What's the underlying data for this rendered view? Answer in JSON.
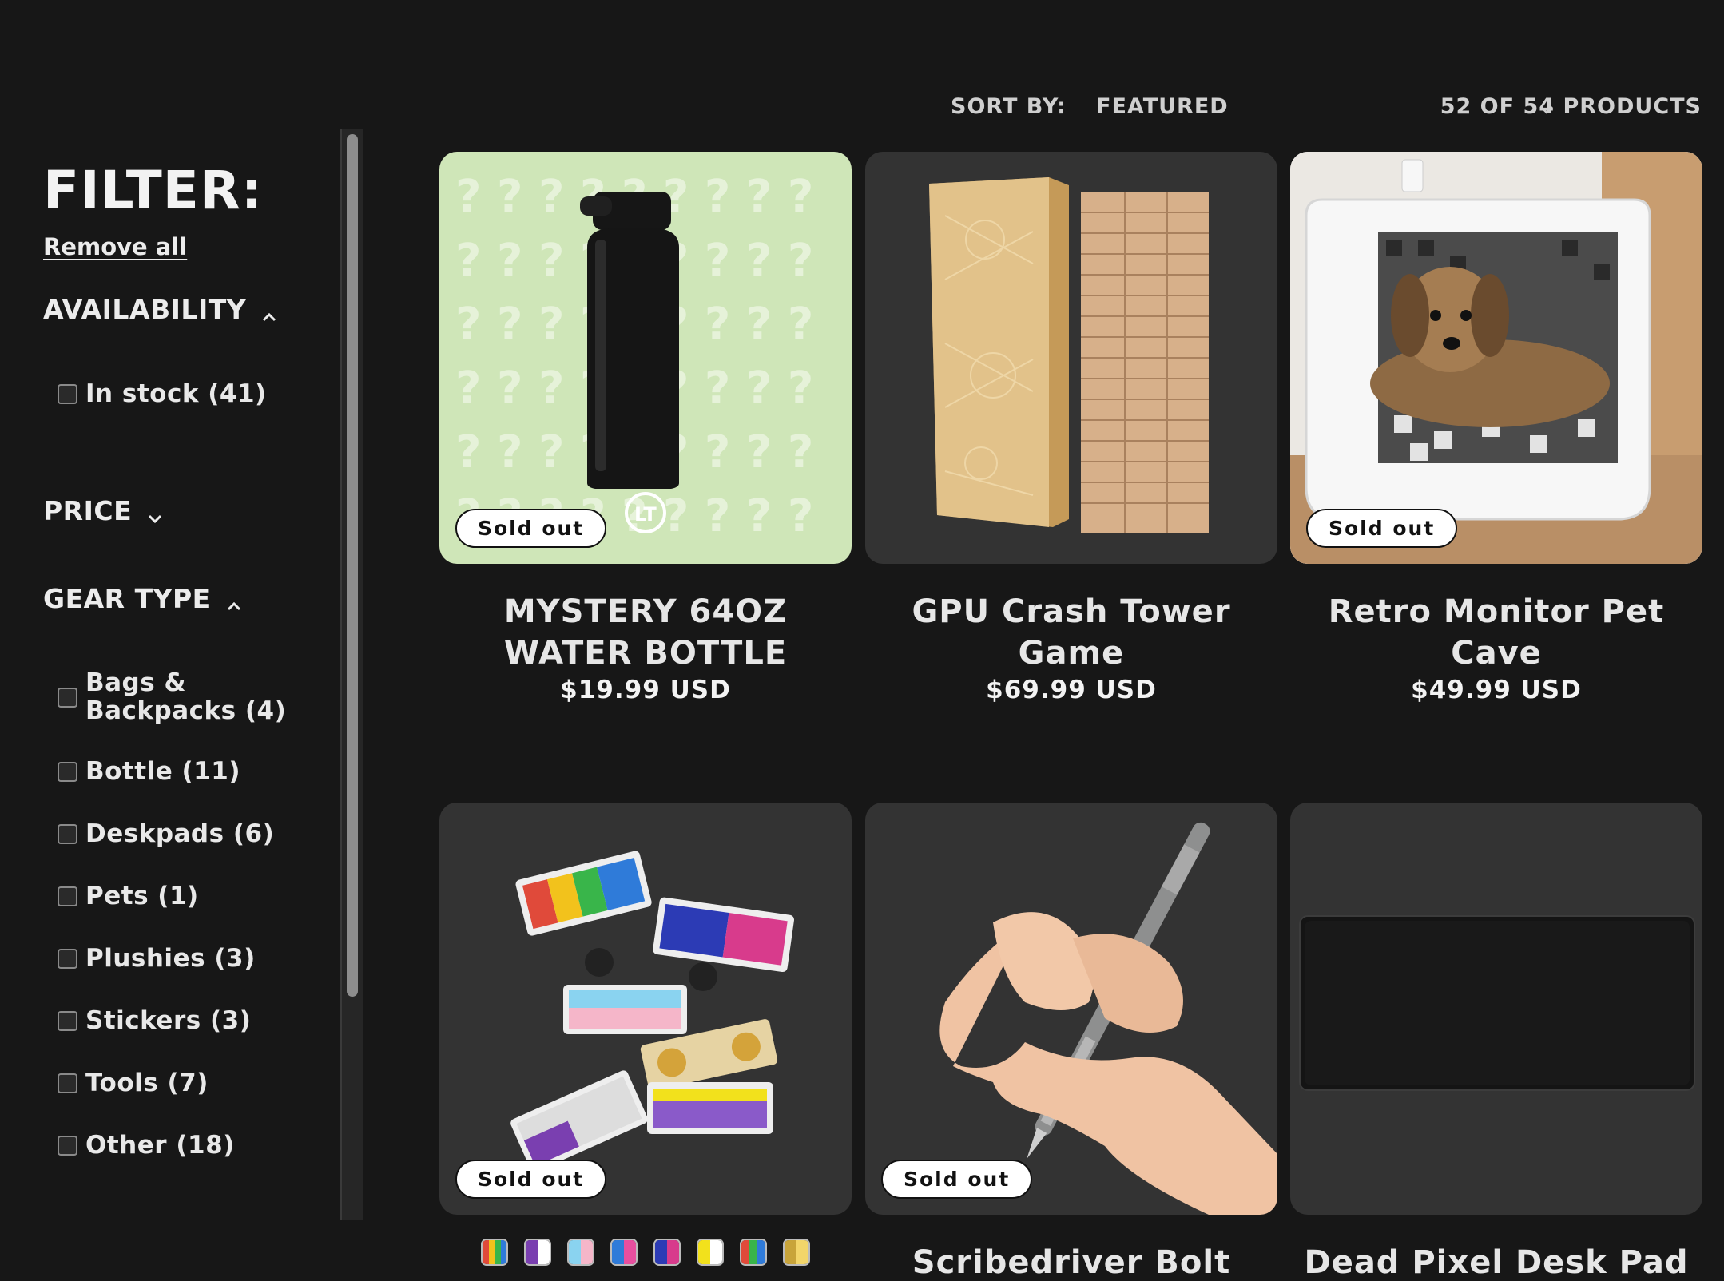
{
  "filters": {
    "title": "FILTER:",
    "remove_all": "Remove all",
    "availability": {
      "label": "AVAILABILITY",
      "options": [
        {
          "label": "In stock (41)"
        }
      ]
    },
    "price": {
      "label": "PRICE"
    },
    "gear_type": {
      "label": "GEAR TYPE",
      "options": [
        {
          "label": "Bags & Backpacks (4)"
        },
        {
          "label": "Bottle (11)"
        },
        {
          "label": "Deskpads (6)"
        },
        {
          "label": "Pets (1)"
        },
        {
          "label": "Plushies (3)"
        },
        {
          "label": "Stickers (3)"
        },
        {
          "label": "Tools (7)"
        },
        {
          "label": "Other (18)"
        }
      ]
    }
  },
  "sort": {
    "label": "SORT BY:",
    "value": "FEATURED",
    "count": "52 OF 54 PRODUCTS"
  },
  "products": [
    {
      "title": "MYSTERY 64OZ WATER BOTTLE",
      "price": "$19.99 USD",
      "badge": "Sold out",
      "image": "black-water-bottle-on-green-question-marks"
    },
    {
      "title": "GPU Crash Tower Game",
      "price": "$69.99 USD",
      "badge": "",
      "image": "wooden-block-tower-and-case"
    },
    {
      "title": "Retro Monitor Pet Cave",
      "price": "$49.99 USD",
      "badge": "Sold out",
      "image": "dog-in-monitor-pet-bed"
    },
    {
      "title": "",
      "price": "",
      "badge": "Sold out",
      "image": "keyboard-enamel-pins",
      "swatch_colors": [
        [
          "#e04a3a",
          "#f2c21c",
          "#39b54a",
          "#2f7bd9"
        ],
        [
          "#7a3fb0",
          "#ffffff"
        ],
        [
          "#8ad3f0",
          "#f5b6c9"
        ],
        [
          "#2f7bd9",
          "#e84f9f"
        ],
        [
          "#2c3bb5",
          "#d83b8c"
        ],
        [
          "#f2e11c",
          "#ffffff"
        ],
        [
          "#e04a3a",
          "#39b54a",
          "#2f7bd9"
        ],
        [
          "#c8a43a",
          "#f2d56a"
        ]
      ]
    },
    {
      "title": "Scribedriver Bolt Action",
      "price": "",
      "badge": "Sold out",
      "image": "hand-holding-metal-pen"
    },
    {
      "title": "Dead Pixel Desk Pad",
      "price": "",
      "badge": "",
      "image": "black-desk-pad"
    }
  ]
}
